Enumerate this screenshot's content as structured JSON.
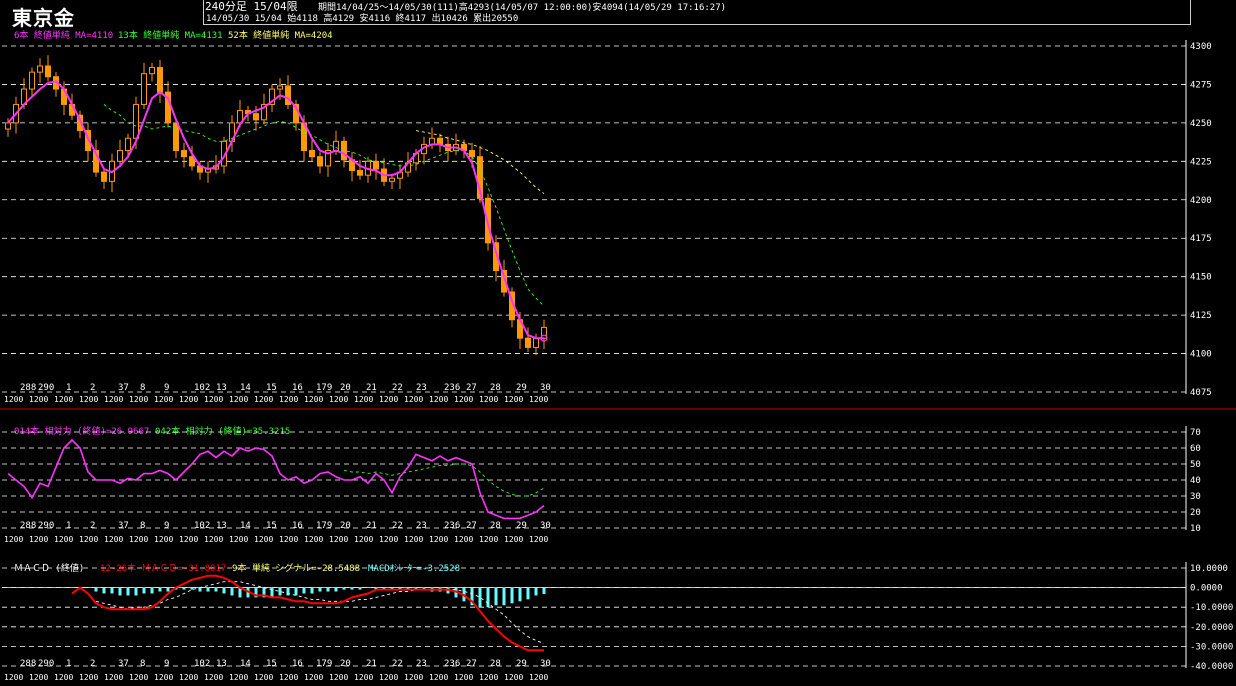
{
  "app": {
    "title": "東京金",
    "header_line1_a": "240分足 15/04限",
    "header_line1_b": "期間14/04/25～14/05/30(111)高4293(14/05/07 12:00:00)安4094(14/05/29 17:16:27)",
    "header_line2": "14/05/30 15/04 始4118 高4129 安4116 終4117 出10426 累出20550"
  },
  "colors": {
    "candle": "#ff9900",
    "ma6": "#ff33ff",
    "ma13": "#33ff33",
    "ma52": "#ffff66",
    "grid": "#ffffff",
    "separator": "#cc0000",
    "macd": "#ff0000",
    "signal": "#ffffff",
    "osc": "#66ffff"
  },
  "chart_data": [
    {
      "type": "candlestick",
      "legend": [
        {
          "text": "6本 終値単純 MA=4110",
          "color": "#ff33ff"
        },
        {
          "text": "13本 終値単純 MA=4131",
          "color": "#33ff33"
        },
        {
          "text": "52本 終値単純 MA=4204",
          "color": "#ffff66"
        }
      ],
      "ylim": [
        4075,
        4300
      ],
      "yticks": [
        "4300",
        "4275",
        "4250",
        "4225",
        "4200",
        "4175",
        "4150",
        "4125",
        "4100",
        "4075"
      ],
      "xticks": [
        "288",
        "290",
        "1",
        "2",
        "37",
        "8",
        "9",
        "102",
        "13",
        "14",
        "15",
        "16",
        "179",
        "20",
        "21",
        "22",
        "23",
        "236",
        "27",
        "28",
        "29",
        "30"
      ],
      "bottom_labels": [
        "1200",
        "1200",
        "1200",
        "1200",
        "1200",
        "1200",
        "1200",
        "1200",
        "1200",
        "1200",
        "1200",
        "1200",
        "1200",
        "1200",
        "1200",
        "1200",
        "1200",
        "1200",
        "1200",
        "1200",
        "1200",
        "1200"
      ],
      "close": [
        4250,
        4262,
        4272,
        4283,
        4287,
        4280,
        4272,
        4262,
        4255,
        4245,
        4232,
        4218,
        4212,
        4225,
        4232,
        4240,
        4262,
        4282,
        4286,
        4270,
        4250,
        4232,
        4228,
        4222,
        4218,
        4220,
        4222,
        4238,
        4250,
        4258,
        4256,
        4252,
        4262,
        4272,
        4274,
        4262,
        4250,
        4232,
        4228,
        4222,
        4232,
        4238,
        4226,
        4219,
        4216,
        4225,
        4220,
        4212,
        4214,
        4218,
        4224,
        4230,
        4236,
        4240,
        4236,
        4232,
        4236,
        4232,
        4228,
        4201,
        4172,
        4154,
        4140,
        4122,
        4110,
        4104,
        4110,
        4117
      ],
      "ma6": [
        4250,
        4256,
        4262,
        4267,
        4272,
        4276,
        4277,
        4272,
        4262,
        4252,
        4240,
        4230,
        4220,
        4218,
        4222,
        4228,
        4238,
        4252,
        4266,
        4270,
        4266,
        4252,
        4240,
        4230,
        4222,
        4220,
        4221,
        4228,
        4238,
        4249,
        4256,
        4258,
        4260,
        4264,
        4268,
        4266,
        4260,
        4250,
        4240,
        4232,
        4230,
        4232,
        4230,
        4226,
        4222,
        4220,
        4219,
        4216,
        4216,
        4218,
        4224,
        4230,
        4234,
        4236,
        4236,
        4234,
        4234,
        4232,
        4224,
        4206,
        4184,
        4166,
        4150,
        4134,
        4122,
        4112,
        4110,
        4110
      ],
      "ma13": [
        null,
        null,
        null,
        null,
        null,
        null,
        null,
        null,
        null,
        null,
        null,
        null,
        4262,
        4258,
        4255,
        4250,
        4248,
        4248,
        4246,
        4247,
        4248,
        4246,
        4245,
        4244,
        4243,
        4240,
        4238,
        4238,
        4240,
        4242,
        4244,
        4246,
        4248,
        4250,
        4251,
        4250,
        4247,
        4244,
        4242,
        4239,
        4236,
        4234,
        4232,
        4231,
        4229,
        4226,
        4225,
        4224,
        4223,
        4222,
        4222,
        4223,
        4225,
        4227,
        4229,
        4231,
        4232,
        4232,
        4228,
        4220,
        4208,
        4195,
        4181,
        4167,
        4154,
        4142,
        4136,
        4131
      ],
      "ma52": [
        null,
        null,
        null,
        null,
        null,
        null,
        null,
        null,
        null,
        null,
        null,
        null,
        null,
        null,
        null,
        null,
        null,
        null,
        null,
        null,
        null,
        null,
        null,
        null,
        null,
        null,
        null,
        null,
        null,
        null,
        null,
        null,
        null,
        null,
        null,
        null,
        null,
        null,
        null,
        null,
        null,
        null,
        null,
        null,
        null,
        null,
        null,
        null,
        null,
        null,
        null,
        4245,
        4244,
        4243,
        4242,
        4240,
        4239,
        4237,
        4236,
        4234,
        4232,
        4229,
        4226,
        4222,
        4218,
        4213,
        4208,
        4204
      ]
    },
    {
      "type": "line",
      "legend": [
        {
          "text": "014本 相対力 (終値)=26.9667",
          "color": "#ff33ff"
        },
        {
          "text": "042本 相対力 (終値)=35.3215",
          "color": "#33ff33"
        }
      ],
      "ylim": [
        10,
        70
      ],
      "yticks": [
        "70",
        "60",
        "50",
        "40",
        "30",
        "20",
        "10"
      ],
      "rsi14": [
        44,
        40,
        36,
        29,
        38,
        36,
        48,
        60,
        65,
        60,
        45,
        40,
        40,
        40,
        38,
        41,
        40,
        44,
        44,
        46,
        44,
        40,
        45,
        50,
        56,
        58,
        54,
        58,
        55,
        60,
        58,
        60,
        59,
        55,
        44,
        40,
        42,
        38,
        40,
        44,
        45,
        42,
        40,
        40,
        42,
        38,
        44,
        40,
        32,
        42,
        48,
        56,
        54,
        52,
        55,
        52,
        54,
        52,
        50,
        32,
        20,
        18,
        16,
        16,
        16,
        18,
        20,
        24
      ],
      "rsi42": [
        null,
        null,
        null,
        null,
        null,
        null,
        null,
        null,
        null,
        null,
        null,
        null,
        null,
        null,
        null,
        null,
        null,
        null,
        null,
        null,
        null,
        null,
        null,
        null,
        null,
        null,
        null,
        null,
        null,
        null,
        null,
        null,
        null,
        null,
        null,
        null,
        null,
        null,
        null,
        null,
        null,
        null,
        46,
        45,
        45,
        44,
        45,
        44,
        43,
        44,
        45,
        46,
        47,
        48,
        49,
        49,
        50,
        50,
        49,
        45,
        40,
        36,
        33,
        31,
        30,
        30,
        32,
        35
      ]
    },
    {
      "type": "line",
      "legend": [
        {
          "text": "ＭＡＣＤ (終値)",
          "color": "#ffffff"
        },
        {
          "text": "12-26本 ＭＡＣＤ=-31.8017",
          "color": "#ff0000"
        },
        {
          "text": "9本 単純 シグナル=-28.5488",
          "color": "#ffff66"
        },
        {
          "text": "MACDｵｼﾚｰﾀｰ=-3.2528",
          "color": "#66ffff"
        }
      ],
      "ylim": [
        -40,
        10
      ],
      "yticks": [
        "10.0000",
        "0.0000",
        "-10.0000",
        "-20.0000",
        "-30.0000",
        "-40.0000"
      ],
      "macd": [
        null,
        null,
        null,
        null,
        null,
        null,
        null,
        null,
        -3,
        0,
        -3,
        -8,
        -10,
        -11,
        -11,
        -11,
        -11,
        -11,
        -10,
        -7,
        -3,
        0,
        2,
        4,
        5,
        6,
        6,
        5,
        3,
        0,
        -2,
        -4,
        -4,
        -5,
        -5,
        -6,
        -7,
        -7,
        -8,
        -8,
        -8,
        -8,
        -7,
        -5,
        -4,
        -3,
        -1,
        -1,
        -1,
        -1,
        -1,
        -1,
        -1,
        -1,
        -1,
        -1,
        -2,
        -4,
        -7,
        -12,
        -17,
        -21,
        -25,
        -28,
        -30,
        -32,
        -32,
        -32
      ],
      "signal": [
        null,
        null,
        null,
        null,
        null,
        null,
        null,
        null,
        null,
        null,
        null,
        -7,
        -8,
        -9,
        -10,
        -11,
        -10,
        -10,
        -9,
        -8,
        -6,
        -5,
        -3,
        -1,
        0,
        1,
        2,
        3,
        3,
        3,
        2,
        1,
        0,
        -1,
        -2,
        -3,
        -4,
        -5,
        -6,
        -6,
        -7,
        -7,
        -7,
        -7,
        -6,
        -6,
        -5,
        -4,
        -3,
        -2,
        -2,
        -1,
        -1,
        -1,
        -1,
        -1,
        -1,
        -2,
        -3,
        -5,
        -8,
        -11,
        -14,
        -18,
        -22,
        -25,
        -27,
        -28.5
      ],
      "osc": [
        null,
        null,
        null,
        null,
        null,
        null,
        null,
        null,
        null,
        null,
        null,
        -2,
        -3,
        -3,
        -4,
        -4,
        -4,
        -3,
        -3,
        -2,
        -2,
        -1,
        -1,
        -1,
        -2,
        -2,
        -2,
        -3,
        -4,
        -5,
        -5,
        -5,
        -5,
        -5,
        -4,
        -4,
        -4,
        -3,
        -3,
        -2,
        -2,
        -2,
        -1,
        -1,
        -1,
        0,
        -1,
        -1,
        -1,
        -1,
        -1,
        -1,
        -1,
        -2,
        -2,
        -3,
        -5,
        -7,
        -9,
        -10,
        -10,
        -9,
        -9,
        -8,
        -7,
        -6,
        -4,
        -3.25
      ]
    }
  ]
}
